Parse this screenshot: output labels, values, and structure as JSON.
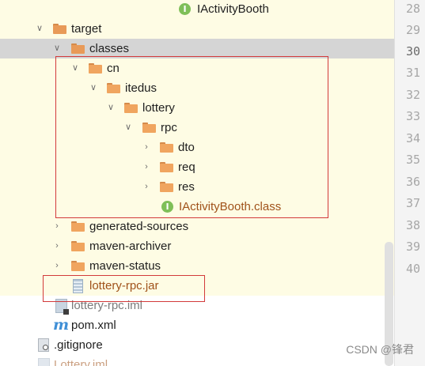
{
  "tree": {
    "top_item": "IActivityBooth",
    "target": "target",
    "classes": "classes",
    "cn": "cn",
    "itedus": "itedus",
    "lottery": "lottery",
    "rpc": "rpc",
    "dto": "dto",
    "req": "req",
    "res": "res",
    "class_file": "IActivityBooth.class",
    "generated_sources": "generated-sources",
    "maven_archiver": "maven-archiver",
    "maven_status": "maven-status",
    "jar": "lottery-rpc.jar",
    "iml": "lottery-rpc.iml",
    "pom": "pom.xml",
    "gitignore": ".gitignore",
    "lottery_iml": "Lottery.iml"
  },
  "icons": {
    "interface": "I",
    "maven": "m"
  },
  "line_numbers": [
    "28",
    "29",
    "30",
    "31",
    "32",
    "33",
    "34",
    "35",
    "36",
    "37",
    "38",
    "39",
    "40"
  ],
  "watermark": "CSDN @锋君",
  "colors": {
    "highlight_row": "#d5d5d5",
    "yellow_row": "#fefce4",
    "red_box": "#d23a3a",
    "folder": "#f0a55f",
    "interface_icon": "#7fbf58",
    "orange_text": "#a0521a"
  }
}
